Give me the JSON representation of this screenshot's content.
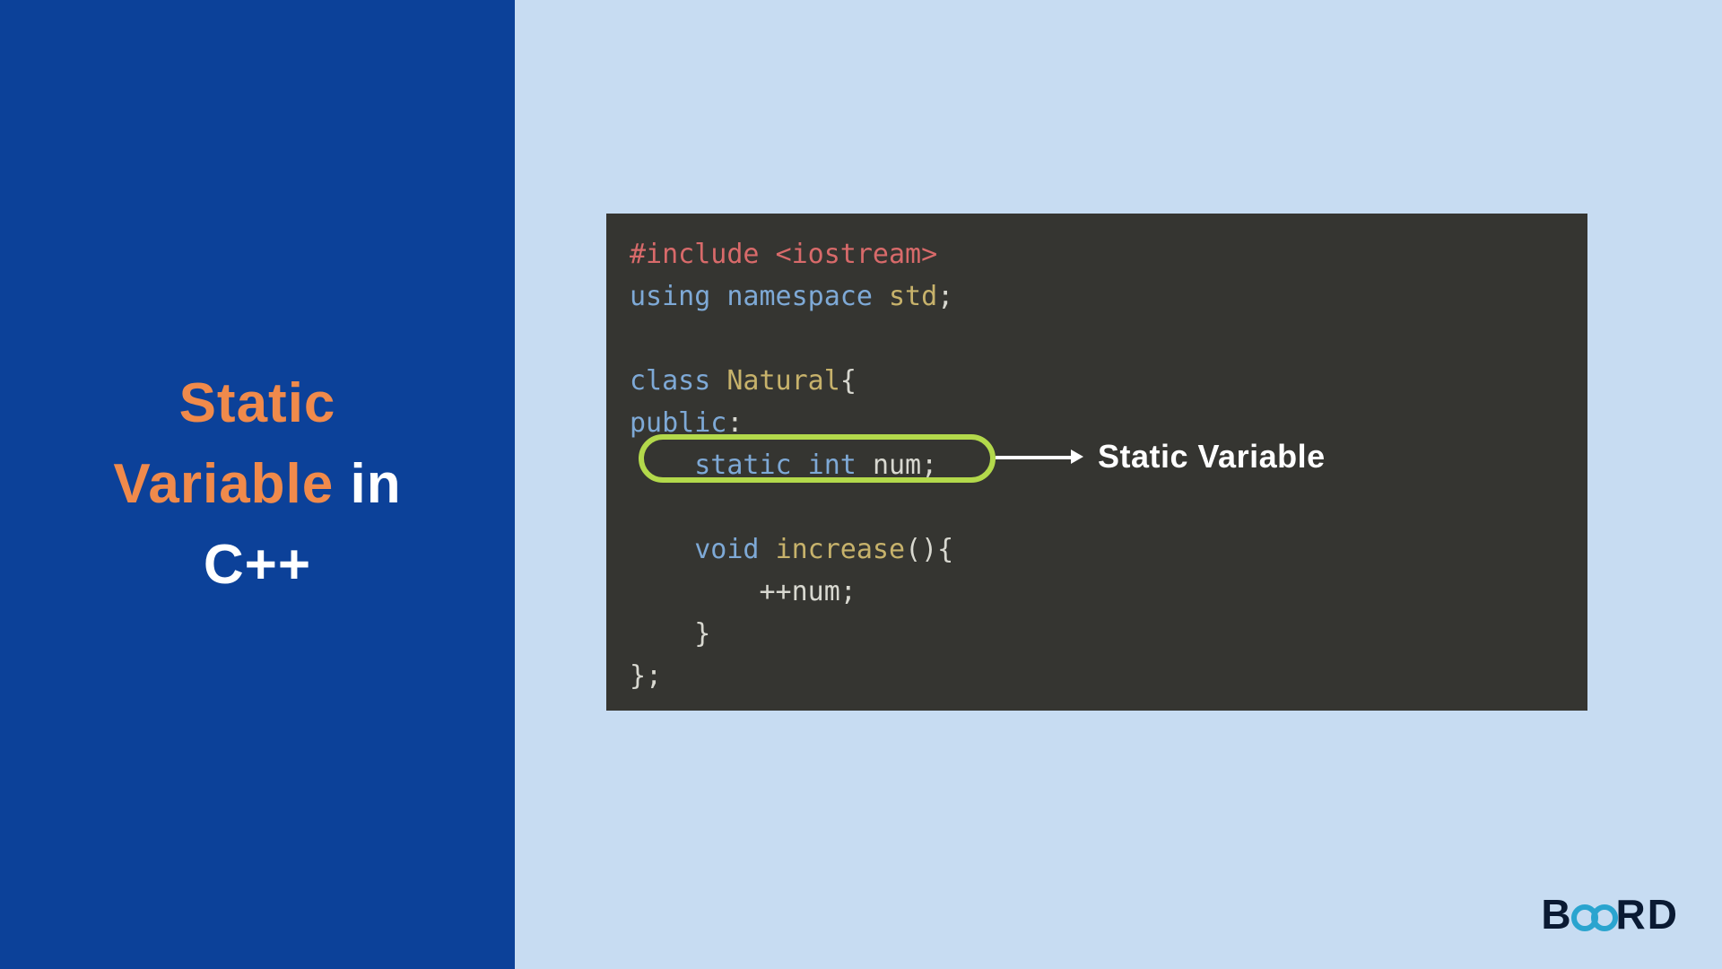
{
  "title": {
    "line1a": "Static",
    "line2a": "Variable",
    "line2b": " in",
    "line3": "C++"
  },
  "code": {
    "l1_a": "#include ",
    "l1_b": "<iostream>",
    "l2_a": "using namespace ",
    "l2_b": "std",
    "l2_c": ";",
    "l3": "",
    "l4_a": "class ",
    "l4_b": "Natural",
    "l4_c": "{",
    "l5_a": "public",
    "l5_b": ":",
    "l6_a": "    static int ",
    "l6_b": "num",
    "l6_c": ";",
    "l7": "",
    "l8_a": "    void ",
    "l8_b": "increase",
    "l8_c": "(){",
    "l9": "        ++num;",
    "l10": "    }",
    "l11": "};"
  },
  "callout": "Static Variable",
  "brand": {
    "pre": "B",
    "post": "RD"
  }
}
